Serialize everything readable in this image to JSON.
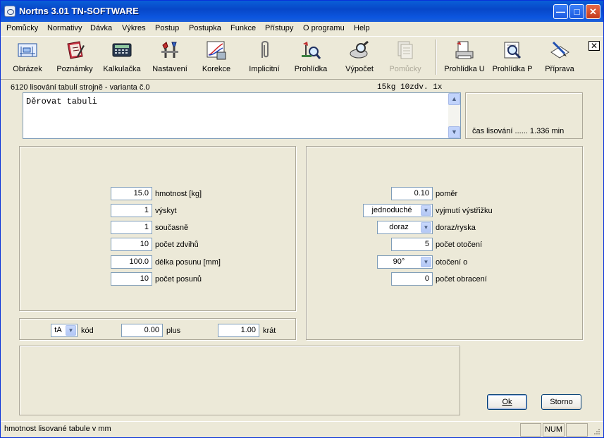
{
  "window": {
    "title": "Nortns 3.01 TN-SOFTWARE"
  },
  "menu": [
    "Pomůcky",
    "Normativy",
    "Dávka",
    "Výkres",
    "Postup",
    "Postupka",
    "Funkce",
    "Přístupy",
    "O programu",
    "Help"
  ],
  "toolbar": [
    "Obrázek",
    "Poznámky",
    "Kalkulačka",
    "Nastavení",
    "Korekce",
    "Implicitní",
    "Prohlídka",
    "Výpočet",
    "Pomůcky",
    "Prohlídka U",
    "Prohlídka P",
    "Příprava"
  ],
  "info": {
    "operation": "6120 lisování tabulí strojně - varianta č.0",
    "params": "15kg 10zdv. 1x"
  },
  "memo": {
    "text": "Děrovat tabuli"
  },
  "time_info": "čas lisování ...... 1.336 min",
  "left_fields": [
    {
      "value": "15.0",
      "label": "hmotnost [kg]"
    },
    {
      "value": "1",
      "label": "výskyt"
    },
    {
      "value": "1",
      "label": "současně"
    },
    {
      "value": "10",
      "label": "počet zdvihů"
    },
    {
      "value": "100.0",
      "label": "délka posunu [mm]"
    },
    {
      "value": "10",
      "label": "počet posunů"
    }
  ],
  "right_fields": {
    "pomer_value": "0.10",
    "pomer_label": "poměr",
    "vyjmuti_value": "jednoduché",
    "vyjmuti_label": "vyjmutí výstřižku",
    "doraz_value": "doraz",
    "doraz_label": "doraz/ryska",
    "otoceni_value": "5",
    "otoceni_label": "počet otočení",
    "otoceni_o_value": "90°",
    "otoceni_o_label": "otočení o",
    "obraceni_value": "0",
    "obraceni_label": "počet obracení"
  },
  "code_row": {
    "kod_value": "tA",
    "kod_label": "kód",
    "plus_value": "0.00",
    "plus_label": "plus",
    "krat_value": "1.00",
    "krat_label": "krát"
  },
  "buttons": {
    "ok": "Ok",
    "storno": "Storno"
  },
  "status": {
    "text": "hmotnost lisované tabule v mm",
    "num": "NUM"
  }
}
